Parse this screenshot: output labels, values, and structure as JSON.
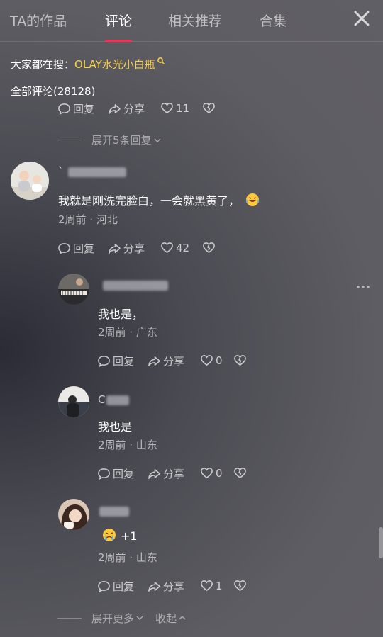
{
  "tabs": [
    {
      "label": "TA的作品"
    },
    {
      "label": "评论"
    },
    {
      "label": "相关推荐"
    },
    {
      "label": "合集"
    }
  ],
  "search": {
    "prefix": "大家都在搜：",
    "keyword": "OLAY水光小白瓶"
  },
  "comments_header": {
    "label": "全部评论(28128)"
  },
  "actions_labels": {
    "reply": "回复",
    "share": "分享"
  },
  "top_actions": {
    "likes": "11"
  },
  "expand_replies": {
    "label": "展开5条回复"
  },
  "comment": {
    "name_visible": "`",
    "text": "我就是刚洗完脸白，一会就黑黄了，",
    "emoji": "laugh-cry-emoji",
    "meta": "2周前 · 河北",
    "likes": "42"
  },
  "replies": [
    {
      "name_visible": "",
      "text": "我也是，",
      "meta": "2周前 · 广东",
      "likes": "0"
    },
    {
      "name_visible": "C",
      "text": "我也是",
      "meta": "2周前 · 山东",
      "likes": "0"
    },
    {
      "name_visible": "",
      "text": "+1",
      "emoji": "crying-emoji",
      "meta": "2周前 · 山东",
      "likes": "1"
    }
  ],
  "footer": {
    "expand_more": "展开更多",
    "collapse": "收起"
  },
  "colors": {
    "accent": "#fe2c55",
    "keyword": "#fad04a"
  }
}
